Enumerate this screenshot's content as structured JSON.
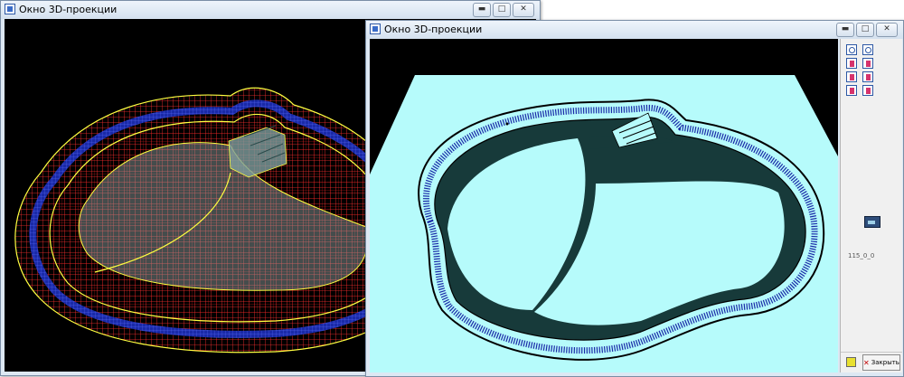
{
  "window_back": {
    "title": "Окно 3D-проекции",
    "controls": {
      "minimize": "▬",
      "restore": "□",
      "close": "✕"
    }
  },
  "window_front": {
    "title": "Окно 3D-проекции",
    "controls": {
      "minimize": "▬",
      "restore": "□",
      "close": "✕"
    },
    "side_panel": {
      "tool_icons": [
        "zoom-in-icon",
        "zoom-out-icon",
        "view-front-icon",
        "view-back-icon",
        "view-left-icon",
        "view-right-icon",
        "view-top-icon",
        "view-bottom-icon"
      ],
      "projection_label": "115_0_0"
    },
    "bottom_bar": {
      "close_label": "Закрыть"
    }
  },
  "colors": {
    "wireframe": "#ff2020",
    "outline": "#ffff40",
    "tiles": "#1a2aa8",
    "water": "#b6fbfb",
    "pool_wall": "#173a3a",
    "background": "#000000"
  }
}
